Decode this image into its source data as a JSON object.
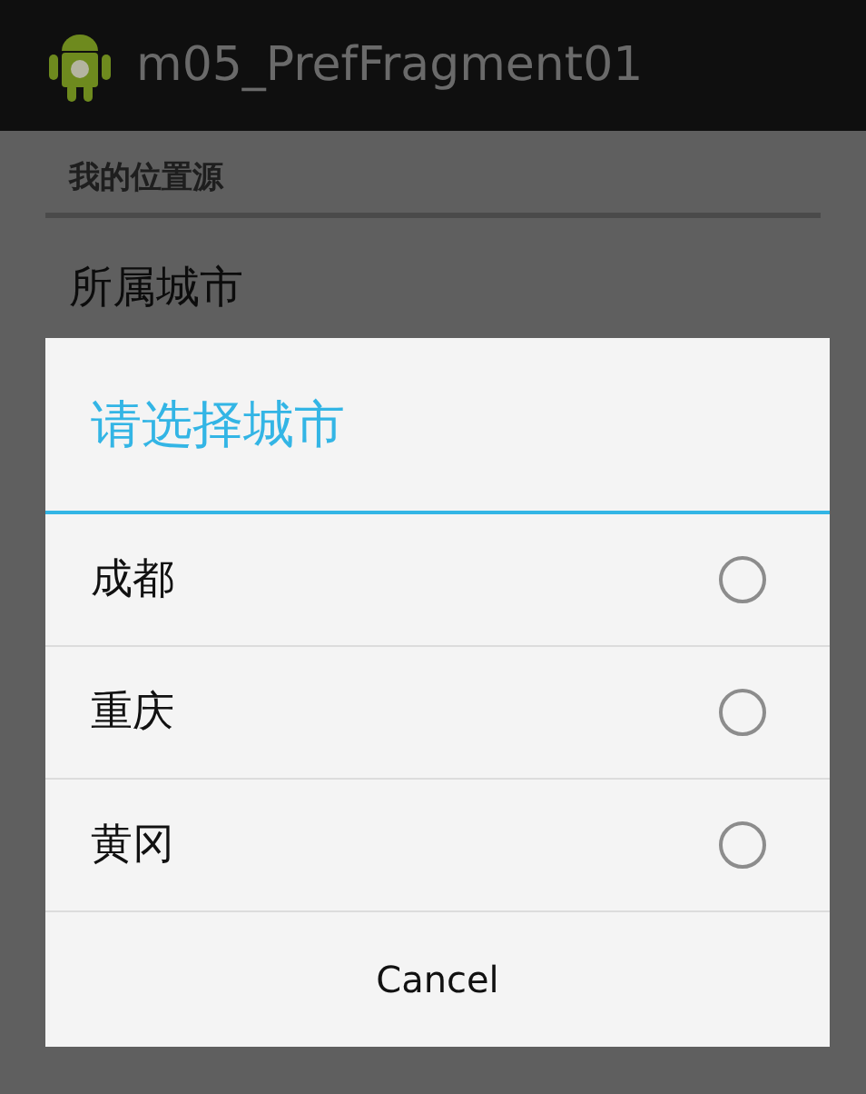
{
  "action_bar": {
    "title": "m05_PrefFragment01"
  },
  "preferences": {
    "category": "我的位置源",
    "item_title": "所属城市"
  },
  "dialog": {
    "title": "请选择城市",
    "options": [
      {
        "label": "成都",
        "selected": false
      },
      {
        "label": "重庆",
        "selected": false
      },
      {
        "label": "黄冈",
        "selected": false
      }
    ],
    "cancel": "Cancel"
  }
}
